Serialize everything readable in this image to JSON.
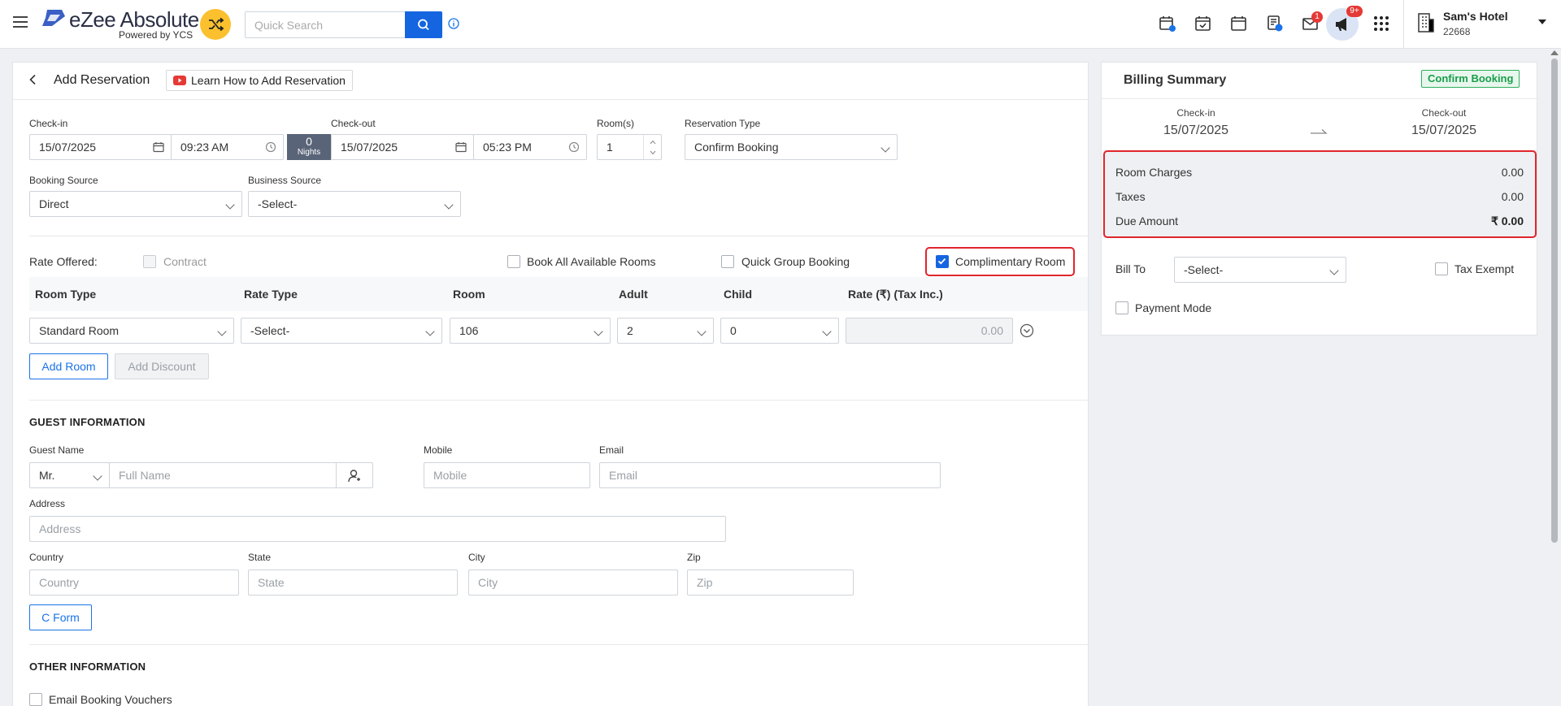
{
  "header": {
    "app_name": "eZee Absolute",
    "app_tagline": "Powered by YCS",
    "search_placeholder": "Quick Search",
    "notification_count": "1",
    "announcement_count": "9+",
    "hotel_name": "Sam's Hotel",
    "hotel_id": "22668"
  },
  "page": {
    "title": "Add Reservation",
    "help_link": "Learn How to Add Reservation"
  },
  "stay": {
    "checkin_label": "Check-in",
    "checkin_date": "15/07/2025",
    "checkin_time": "09:23 AM",
    "nights_count": "0",
    "nights_label": "Nights",
    "checkout_label": "Check-out",
    "checkout_date": "15/07/2025",
    "checkout_time": "05:23 PM",
    "rooms_label": "Room(s)",
    "rooms_value": "1",
    "reservation_type_label": "Reservation Type",
    "reservation_type_value": "Confirm Booking",
    "booking_source_label": "Booking Source",
    "booking_source_value": "Direct",
    "business_source_label": "Business Source",
    "business_source_value": "-Select-"
  },
  "rate": {
    "rate_offered_label": "Rate Offered:",
    "contract_label": "Contract",
    "book_all_label": "Book All Available Rooms",
    "quick_group_label": "Quick Group Booking",
    "complimentary_label": "Complimentary Room",
    "complimentary_checked": true
  },
  "room_table": {
    "headers": [
      "Room Type",
      "Rate Type",
      "Room",
      "Adult",
      "Child",
      "Rate (₹)  (Tax Inc.)"
    ],
    "row": {
      "room_type": "Standard Room",
      "rate_type": "-Select-",
      "room": "106",
      "adult": "2",
      "child": "0",
      "rate": "0.00"
    },
    "add_room_label": "Add Room",
    "add_discount_label": "Add Discount"
  },
  "guest": {
    "section_title": "GUEST INFORMATION",
    "guest_name_label": "Guest Name",
    "salutation": "Mr.",
    "full_name_placeholder": "Full Name",
    "mobile_label": "Mobile",
    "mobile_placeholder": "Mobile",
    "email_label": "Email",
    "email_placeholder": "Email",
    "address_label": "Address",
    "address_placeholder": "Address",
    "country_label": "Country",
    "country_placeholder": "Country",
    "state_label": "State",
    "state_placeholder": "State",
    "city_label": "City",
    "city_placeholder": "City",
    "zip_label": "Zip",
    "zip_placeholder": "Zip",
    "cform_label": "C Form"
  },
  "other": {
    "section_title": "OTHER INFORMATION",
    "email_vouchers_label": "Email Booking Vouchers"
  },
  "billing": {
    "title": "Billing Summary",
    "status_badge": "Confirm Booking",
    "checkin_label": "Check-in",
    "checkin_date": "15/07/2025",
    "checkout_label": "Check-out",
    "checkout_date": "15/07/2025",
    "room_charges_label": "Room Charges",
    "room_charges_value": "0.00",
    "taxes_label": "Taxes",
    "taxes_value": "0.00",
    "due_amount_label": "Due Amount",
    "due_amount_value": "₹ 0.00",
    "bill_to_label": "Bill To",
    "bill_to_value": "-Select-",
    "tax_exempt_label": "Tax Exempt",
    "payment_mode_label": "Payment Mode"
  },
  "colors": {
    "accent": "#1565e0",
    "highlight_outline": "#e0252c",
    "badge_green": "#1a9e4b",
    "nights_box": "#5a6478"
  }
}
